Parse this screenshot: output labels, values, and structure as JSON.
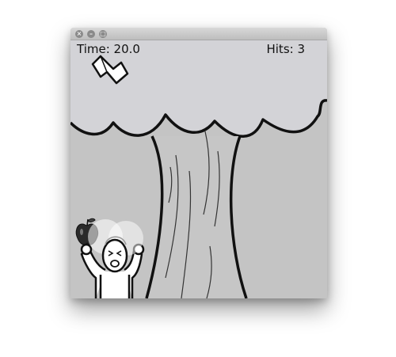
{
  "window": {
    "close_glyph": "×",
    "minimize_glyph": "–",
    "maximize_glyph": "□"
  },
  "hud": {
    "time_label": "Time: 20.0",
    "hits_label": "Hits: 3"
  },
  "colors": {
    "sky": "#d3d3d7",
    "ground": "#c4c4c4",
    "outline": "#111111",
    "apple": "#2a2a2a",
    "character": "#ffffff"
  }
}
